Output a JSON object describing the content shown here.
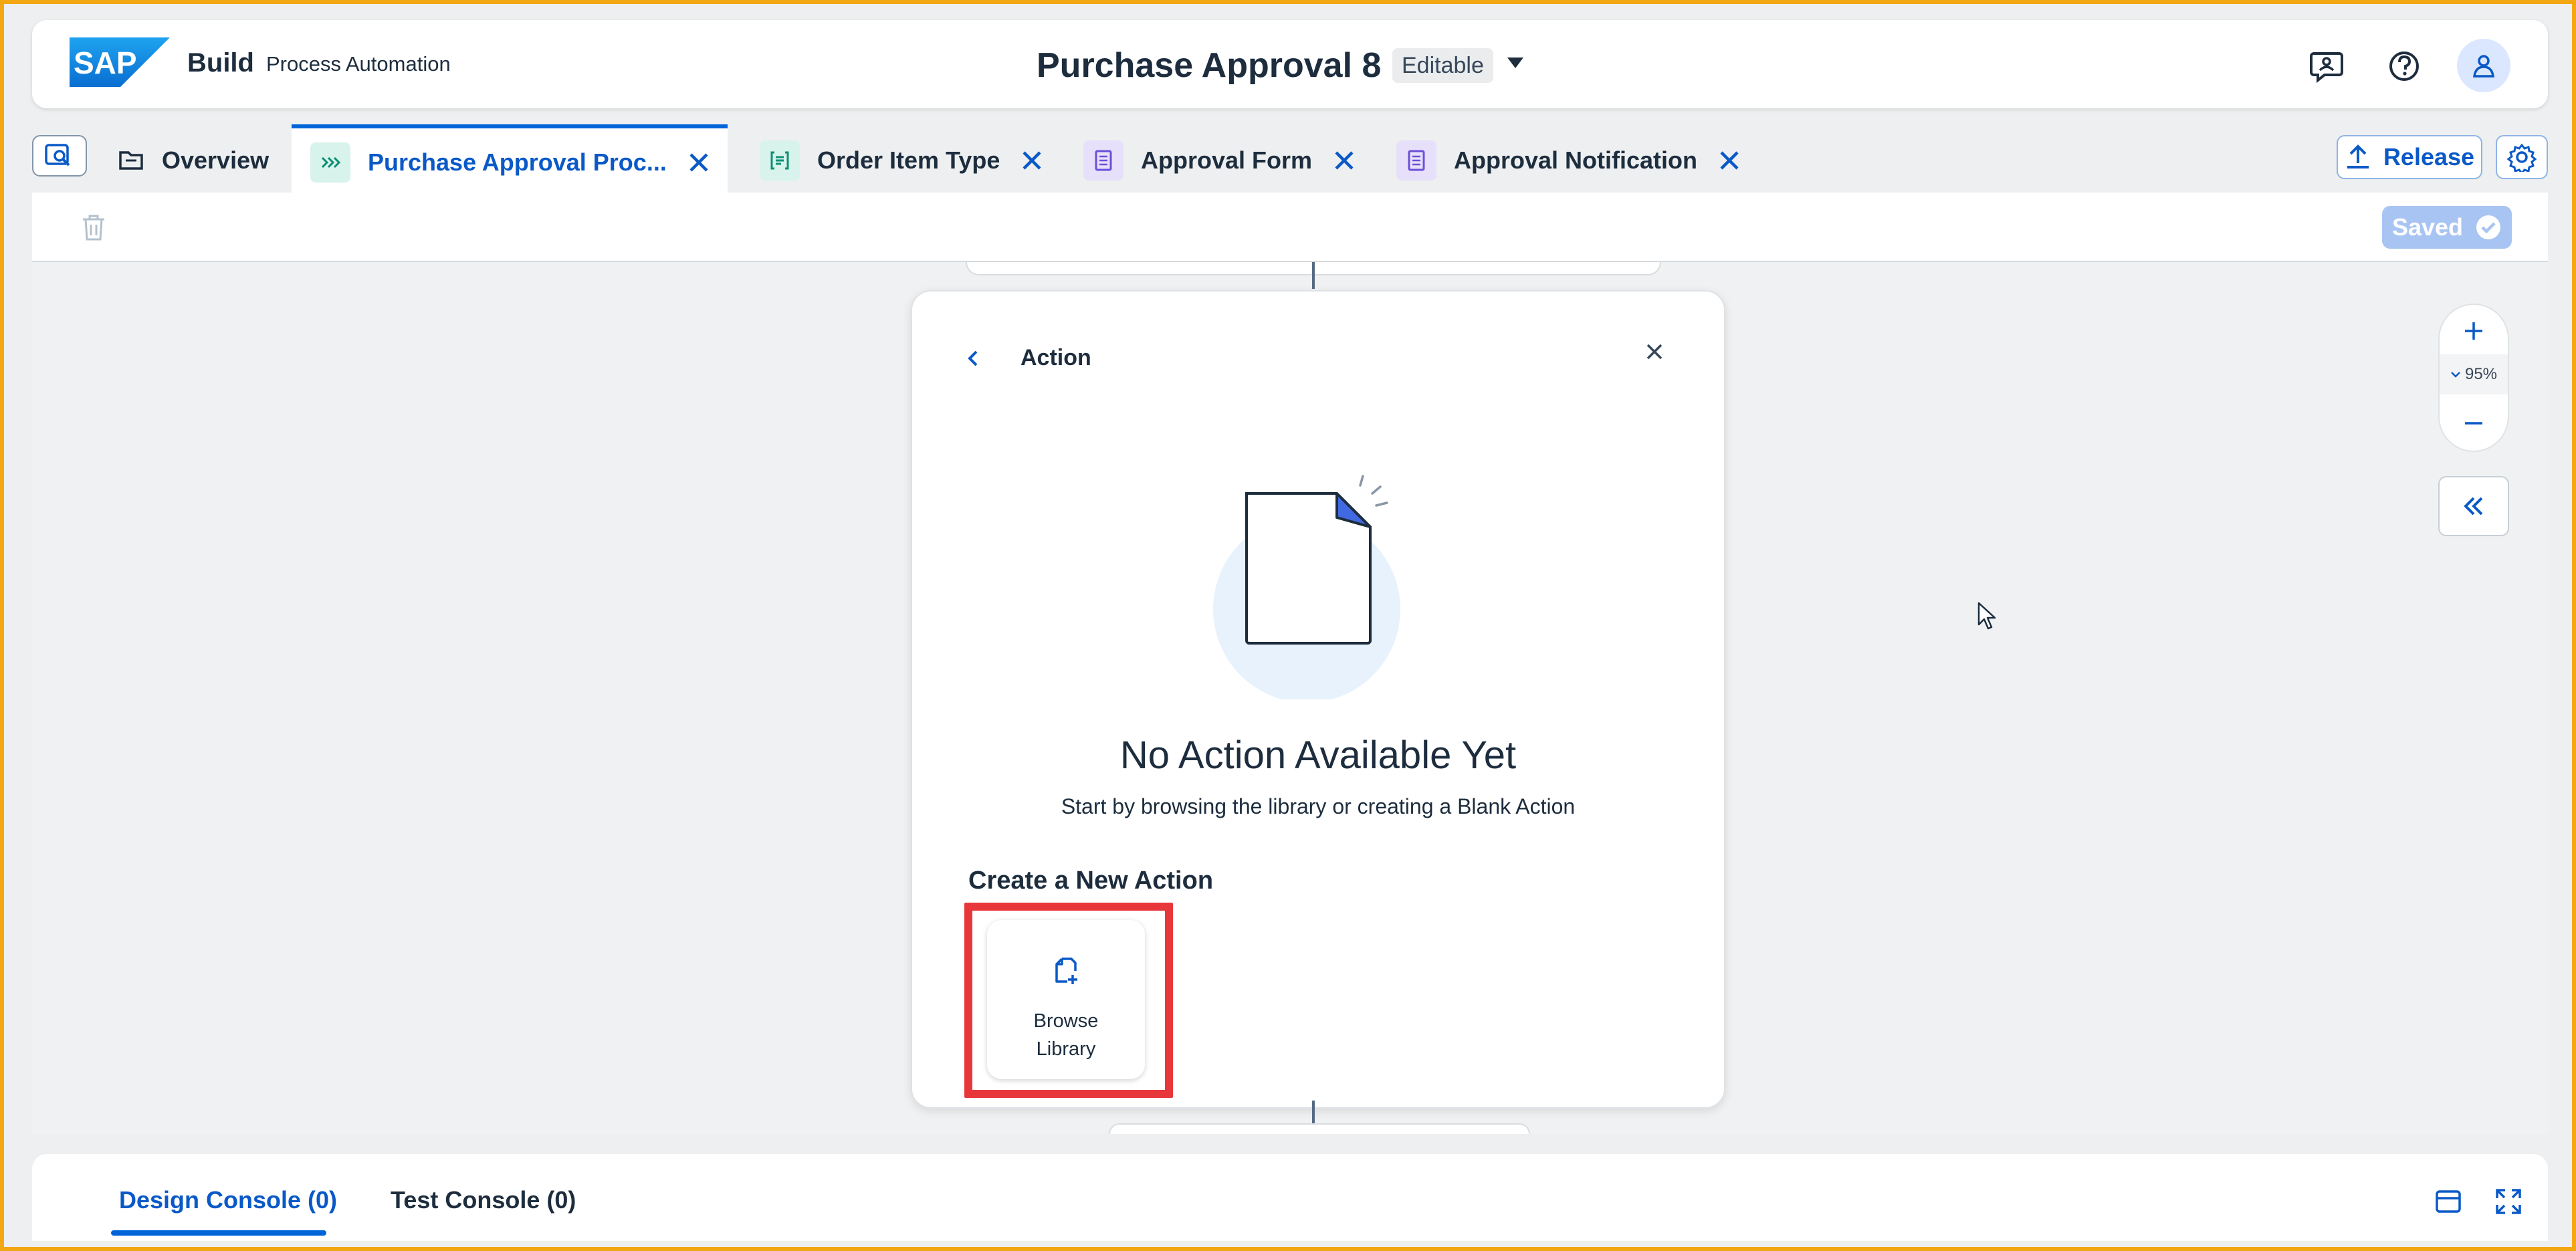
{
  "shell": {
    "logo_text": "SAP",
    "brand": "Build",
    "product": "Process Automation",
    "title": "Purchase Approval 8",
    "status_badge": "Editable",
    "icons": [
      "feedback-icon",
      "help-icon",
      "user-icon"
    ]
  },
  "tabs": [
    {
      "label": "Overview",
      "icon": "folder-icon",
      "active": false,
      "closable": false
    },
    {
      "label": "Purchase Approval Proc...",
      "icon": "process-icon",
      "active": true,
      "closable": true
    },
    {
      "label": "Order Item Type",
      "icon": "data-type-icon",
      "active": false,
      "closable": true
    },
    {
      "label": "Approval Form",
      "icon": "form-icon",
      "active": false,
      "closable": true
    },
    {
      "label": "Approval Notification",
      "icon": "form-icon",
      "active": false,
      "closable": true
    }
  ],
  "actions": {
    "release_label": "Release",
    "saved_label": "Saved"
  },
  "panel": {
    "title": "Action",
    "empty_title": "No Action Available Yet",
    "empty_subtitle": "Start by browsing the library or creating a Blank Action",
    "create_heading": "Create a New Action",
    "browse_label": "Browse Library"
  },
  "zoom": {
    "level": "95%"
  },
  "console": {
    "tabs": [
      {
        "label": "Design Console (0)",
        "active": true
      },
      {
        "label": "Test Console (0)",
        "active": false
      }
    ]
  },
  "colors": {
    "accent": "#0064d9",
    "highlight": "#e8373b",
    "frame": "#f3a712"
  }
}
